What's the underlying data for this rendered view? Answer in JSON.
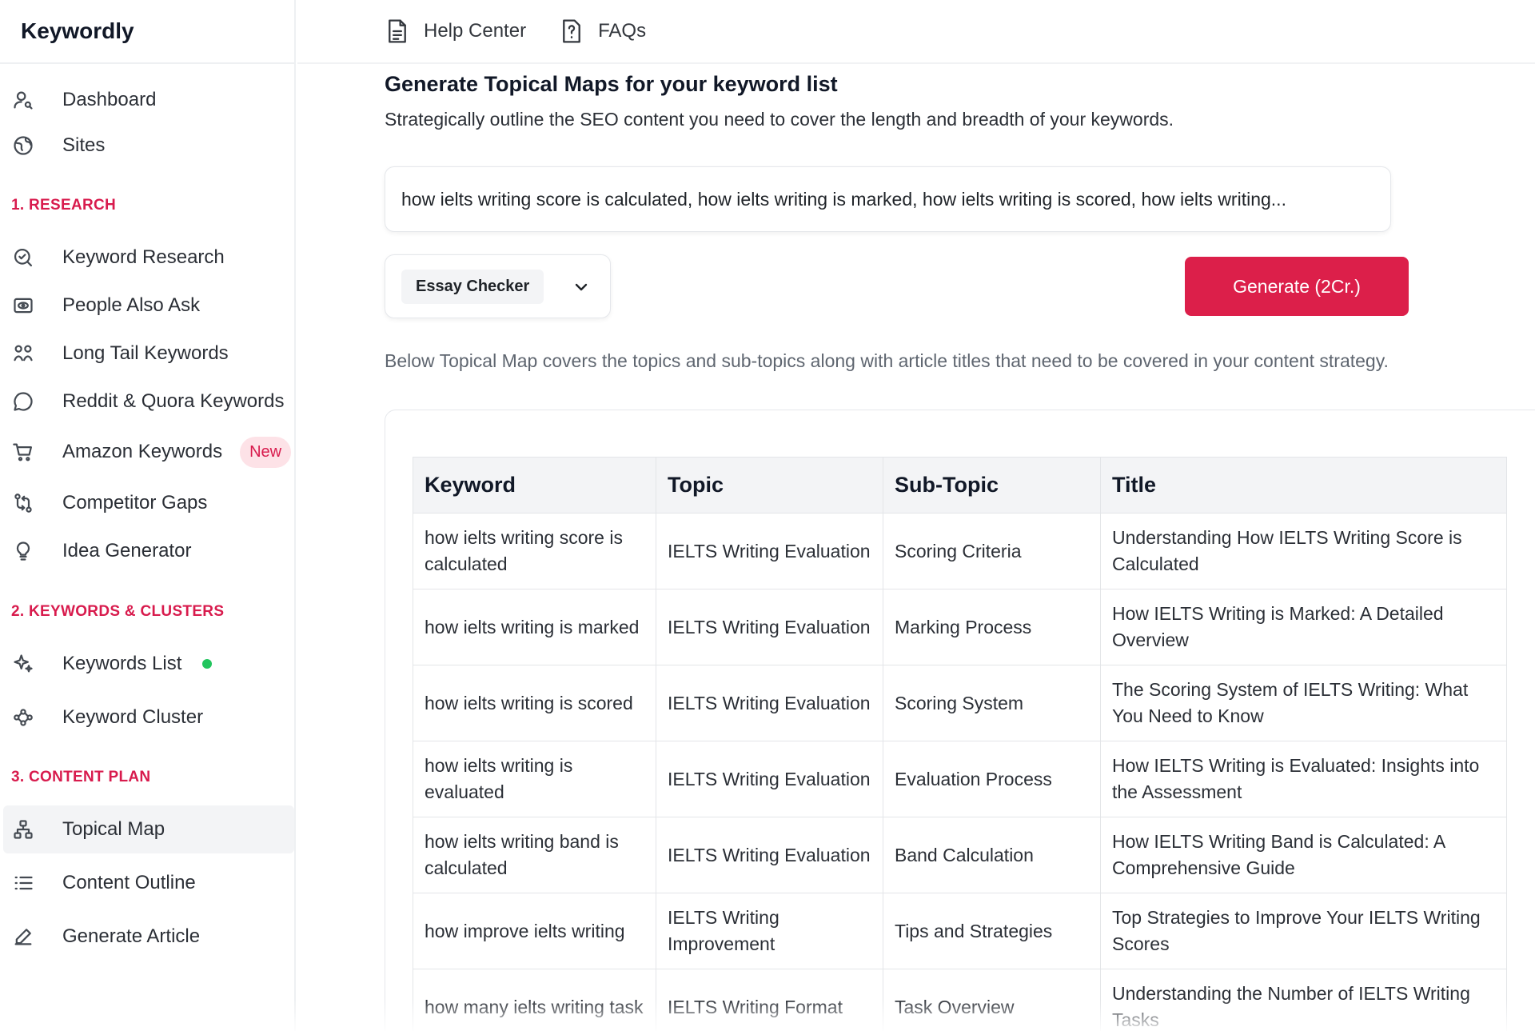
{
  "app": {
    "name": "Keywordly"
  },
  "topbar": {
    "help_label": "Help Center",
    "faq_label": "FAQs"
  },
  "sidebar": {
    "dashboard": "Dashboard",
    "sites": "Sites",
    "section_research": "1. RESEARCH",
    "keyword_research": "Keyword Research",
    "people_also_ask": "People Also Ask",
    "long_tail": "Long Tail Keywords",
    "reddit_quora": "Reddit & Quora Keywords",
    "amazon": "Amazon Keywords",
    "amazon_badge": "New",
    "competitor_gaps": "Competitor Gaps",
    "idea_generator": "Idea Generator",
    "section_keywords": "2. KEYWORDS & CLUSTERS",
    "keywords_list": "Keywords List",
    "keyword_cluster": "Keyword Cluster",
    "section_content": "3. CONTENT PLAN",
    "topical_map": "Topical Map",
    "content_outline": "Content Outline",
    "generate_article": "Generate Article"
  },
  "main": {
    "title": "Generate Topical Maps for your keyword list",
    "subtitle": "Strategically outline the SEO content you need to cover the length and breadth of your keywords.",
    "keyword_input_value": "how ielts writing score is calculated, how ielts writing is marked, how ielts writing is scored, how ielts writing...",
    "selected_site": "Essay Checker",
    "generate_button": "Generate (2Cr.)",
    "description": "Below Topical Map covers the topics and sub-topics along with article titles that need to be covered in your content strategy."
  },
  "table": {
    "headers": [
      "Keyword",
      "Topic",
      "Sub-Topic",
      "Title"
    ],
    "rows": [
      [
        "how ielts writing score is calculated",
        "IELTS Writing Evaluation",
        "Scoring Criteria",
        "Understanding How IELTS Writing Score is Calculated"
      ],
      [
        "how ielts writing is marked",
        "IELTS Writing Evaluation",
        "Marking Process",
        "How IELTS Writing is Marked: A Detailed Overview"
      ],
      [
        "how ielts writing is scored",
        "IELTS Writing Evaluation",
        "Scoring System",
        "The Scoring System of IELTS Writing: What You Need to Know"
      ],
      [
        "how ielts writing is evaluated",
        "IELTS Writing Evaluation",
        "Evaluation Process",
        "How IELTS Writing is Evaluated: Insights into the Assessment"
      ],
      [
        "how ielts writing band is calculated",
        "IELTS Writing Evaluation",
        "Band Calculation",
        "How IELTS Writing Band is Calculated: A Comprehensive Guide"
      ],
      [
        "how improve ielts writing",
        "IELTS Writing Improvement",
        "Tips and Strategies",
        "Top Strategies to Improve Your IELTS Writing Scores"
      ],
      [
        "how many ielts writing task",
        "IELTS Writing Format",
        "Task Overview",
        "Understanding the Number of IELTS Writing Tasks"
      ]
    ]
  },
  "colors": {
    "accent": "#dc1f4a",
    "section_label": "#d81b4d",
    "badge_bg": "#fde2e7",
    "status_dot": "#22c55e"
  },
  "icons": [
    "user-icon",
    "globe-icon",
    "search-icon",
    "eye-icon",
    "tags-icon",
    "chat-icon",
    "cart-icon",
    "git-compare-icon",
    "lightbulb-icon",
    "sparkles-icon",
    "cluster-icon",
    "sitemap-icon",
    "list-icon",
    "pen-icon",
    "document-icon",
    "help-icon",
    "chevron-down-icon"
  ]
}
